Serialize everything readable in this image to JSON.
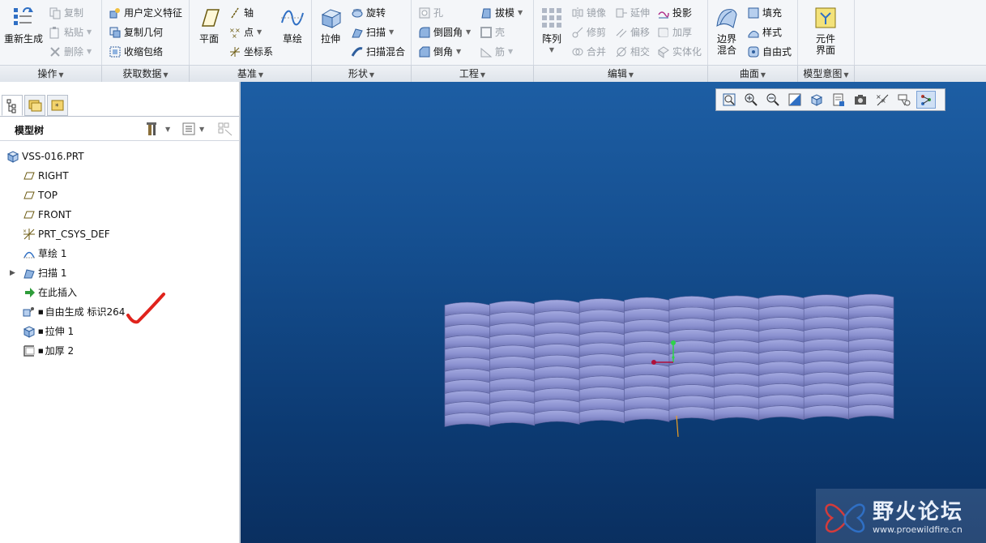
{
  "ribbon": {
    "groups": {
      "operations": {
        "label": "操作",
        "regenerate": "重新生成",
        "copy": "复制",
        "paste": "粘贴",
        "delete": "删除"
      },
      "get_data": {
        "label": "获取数据",
        "user_defined_feature": "用户定义特征",
        "copy_geometry": "复制几何",
        "shrinkwrap": "收缩包络"
      },
      "datum": {
        "label": "基准",
        "plane": "平面",
        "axis": "轴",
        "point": "点",
        "csys": "坐标系",
        "sketch": "草绘"
      },
      "shapes": {
        "label": "形状",
        "extrude": "拉伸",
        "revolve": "旋转",
        "sweep": "扫描",
        "swept_blend": "扫描混合"
      },
      "engineering": {
        "label": "工程",
        "hole": "孔",
        "round": "倒圆角",
        "chamfer": "倒角",
        "draft": "拔模",
        "shell": "壳",
        "rib": "筋"
      },
      "editing": {
        "label": "编辑",
        "pattern": "阵列",
        "mirror": "镜像",
        "trim": "修剪",
        "merge": "合并",
        "extend": "延伸",
        "offset": "偏移",
        "intersect": "相交",
        "project": "投影",
        "thicken": "加厚",
        "solidify": "实体化"
      },
      "surfaces": {
        "label": "曲面",
        "boundary_blend": "边界\n混合",
        "fill": "填充",
        "style": "样式",
        "freestyle": "自由式"
      },
      "model_intent": {
        "label": "模型意图",
        "component_interface": "元件\n界面"
      }
    }
  },
  "model_tree": {
    "title": "模型树",
    "items": [
      {
        "label": "VSS-016.PRT",
        "icon": "part-icon"
      },
      {
        "label": "RIGHT",
        "icon": "datum-plane-icon"
      },
      {
        "label": "TOP",
        "icon": "datum-plane-icon"
      },
      {
        "label": "FRONT",
        "icon": "datum-plane-icon"
      },
      {
        "label": "PRT_CSYS_DEF",
        "icon": "csys-icon"
      },
      {
        "label": "草绘 1",
        "icon": "sketch-icon"
      },
      {
        "label": "扫描 1",
        "icon": "sweep-icon"
      },
      {
        "label": "在此插入",
        "icon": "insert-here-icon"
      },
      {
        "label": "自由生成 标识264",
        "icon": "freeform-icon"
      },
      {
        "label": "拉伸 1",
        "icon": "extrude-icon"
      },
      {
        "label": "加厚 2",
        "icon": "thicken-icon"
      }
    ]
  },
  "watermark": {
    "title": "野火论坛",
    "url": "www.proewildfire.cn"
  },
  "colors": {
    "surface": "#8d93d0",
    "surface_edge": "#5d639e",
    "viewport_top": "#1d5ea4",
    "viewport_bottom": "#0a2f60",
    "checkmark": "#e0231c"
  }
}
